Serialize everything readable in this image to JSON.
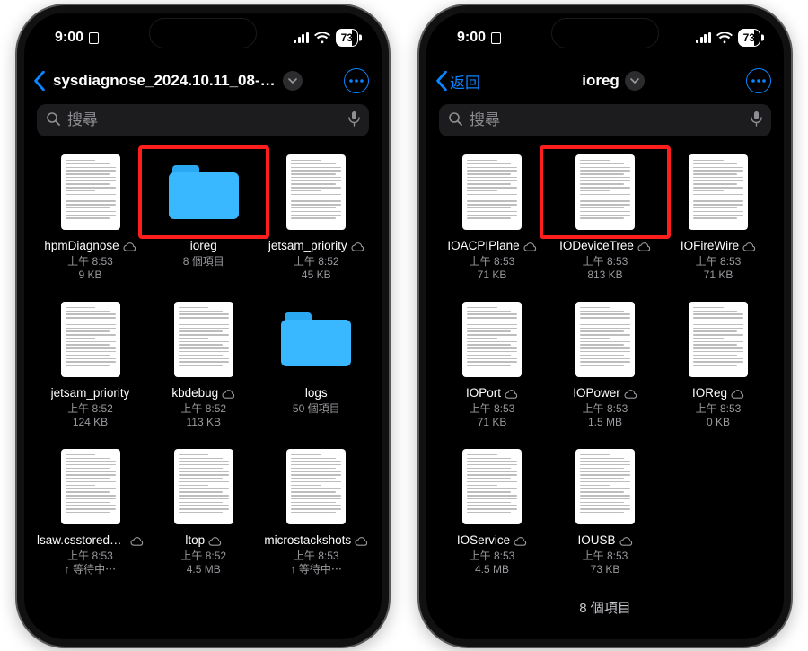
{
  "status": {
    "time": "9:00",
    "battery": "73"
  },
  "search": {
    "placeholder": "搜尋"
  },
  "left": {
    "title": "sysdiagnose_2024.10.11_08-52...",
    "backLabel": "",
    "items": [
      {
        "name": "hpmDiagnose",
        "type": "doc",
        "cloud": true,
        "hl": false,
        "meta1": "上午 8:53",
        "meta2": "9 KB"
      },
      {
        "name": "ioreg",
        "type": "folder",
        "cloud": false,
        "hl": true,
        "meta1": "8 個項目",
        "meta2": ""
      },
      {
        "name": "jetsam_priority",
        "type": "doc",
        "cloud": true,
        "hl": false,
        "meta1": "上午 8:52",
        "meta2": "45 KB"
      },
      {
        "name": "jetsam_priority",
        "type": "doc",
        "cloud": false,
        "hl": false,
        "meta1": "上午 8:52",
        "meta2": "124 KB"
      },
      {
        "name": "kbdebug",
        "type": "doc",
        "cloud": true,
        "hl": false,
        "meta1": "上午 8:52",
        "meta2": "113 KB"
      },
      {
        "name": "logs",
        "type": "folder",
        "cloud": false,
        "hl": false,
        "meta1": "50 個項目",
        "meta2": ""
      },
      {
        "name": "lsaw.csstoredump",
        "type": "doc",
        "cloud": true,
        "hl": false,
        "meta1": "上午 8:53",
        "meta2": "↑ 等待中⋯"
      },
      {
        "name": "ltop",
        "type": "doc",
        "cloud": true,
        "hl": false,
        "meta1": "上午 8:52",
        "meta2": "4.5 MB"
      },
      {
        "name": "microstackshots",
        "type": "doc",
        "cloud": true,
        "hl": false,
        "meta1": "上午 8:53",
        "meta2": "↑ 等待中⋯"
      }
    ]
  },
  "right": {
    "title": "ioreg",
    "backLabel": "返回",
    "footer": "8 個項目",
    "items": [
      {
        "name": "IOACPIPlane",
        "type": "doc",
        "cloud": true,
        "hl": false,
        "meta1": "上午 8:53",
        "meta2": "71 KB"
      },
      {
        "name": "IODeviceTree",
        "type": "doc",
        "cloud": true,
        "hl": true,
        "meta1": "上午 8:53",
        "meta2": "813 KB"
      },
      {
        "name": "IOFireWire",
        "type": "doc",
        "cloud": true,
        "hl": false,
        "meta1": "上午 8:53",
        "meta2": "71 KB"
      },
      {
        "name": "IOPort",
        "type": "doc",
        "cloud": true,
        "hl": false,
        "meta1": "上午 8:53",
        "meta2": "71 KB"
      },
      {
        "name": "IOPower",
        "type": "doc",
        "cloud": true,
        "hl": false,
        "meta1": "上午 8:53",
        "meta2": "1.5 MB"
      },
      {
        "name": "IOReg",
        "type": "doc",
        "cloud": true,
        "hl": false,
        "meta1": "上午 8:53",
        "meta2": "0 KB"
      },
      {
        "name": "IOService",
        "type": "doc",
        "cloud": true,
        "hl": false,
        "meta1": "上午 8:53",
        "meta2": "4.5 MB"
      },
      {
        "name": "IOUSB",
        "type": "doc",
        "cloud": true,
        "hl": false,
        "meta1": "上午 8:53",
        "meta2": "73 KB"
      }
    ]
  }
}
